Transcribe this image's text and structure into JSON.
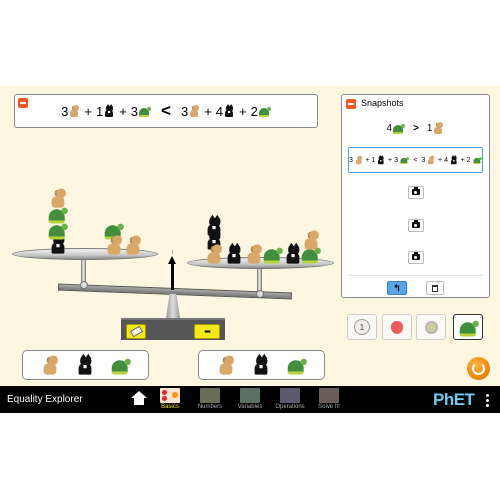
{
  "main_equation": {
    "left": [
      {
        "coefficient": "3",
        "item": "dog"
      },
      {
        "coefficient": "1",
        "item": "cat"
      },
      {
        "coefficient": "3",
        "item": "turtle"
      }
    ],
    "relation": "<",
    "right": [
      {
        "coefficient": "3",
        "item": "dog"
      },
      {
        "coefficient": "4",
        "item": "cat"
      },
      {
        "coefficient": "2",
        "item": "turtle"
      }
    ],
    "operator": "+"
  },
  "snapshots": {
    "title": "Snapshots",
    "items": [
      {
        "text_left": "4",
        "left_item": "turtle",
        "relation": ">",
        "text_right": "1",
        "right_item": "dog",
        "selected": false
      },
      {
        "left": [
          "3",
          "1",
          "3"
        ],
        "relation": "<",
        "right": [
          "3",
          "4",
          "2"
        ],
        "selected": true
      },
      {
        "empty": true,
        "icon": "camera-icon"
      },
      {
        "empty": true,
        "icon": "camera-icon"
      },
      {
        "empty": true,
        "icon": "camera-icon"
      }
    ],
    "restore_icon": "restore-arrow-icon",
    "trash_icon": "trash-icon"
  },
  "scale": {
    "tilt": "right-side-down",
    "left_pan": {
      "dog": 3,
      "cat": 1,
      "turtle": 3
    },
    "right_pan": {
      "dog": 3,
      "cat": 4,
      "turtle": 2
    },
    "clear_icon": "eraser-icon",
    "organize_icon": "organize-icon"
  },
  "left_toolbox": [
    "dog",
    "cat",
    "turtle"
  ],
  "right_toolbox": [
    "dog",
    "cat",
    "turtle"
  ],
  "scene_selector": {
    "options": [
      {
        "name": "numbers",
        "label": "1",
        "selected": false
      },
      {
        "name": "apple",
        "label": "",
        "selected": false
      },
      {
        "name": "coin",
        "label": "",
        "selected": false
      },
      {
        "name": "animals",
        "label": "",
        "selected": true
      }
    ]
  },
  "navbar": {
    "title": "Equality Explorer",
    "tabs": [
      {
        "label": "Basics",
        "selected": true
      },
      {
        "label": "Numbers",
        "selected": false
      },
      {
        "label": "Variables",
        "selected": false
      },
      {
        "label": "Operations",
        "selected": false
      },
      {
        "label": "Solve It!",
        "selected": false
      }
    ],
    "logo": "PhET",
    "colors": {
      "selected_tab": "#f2e916",
      "logo_blue": "#6fcbf0",
      "logo_yellow": "#f2e916"
    }
  },
  "colors": {
    "background": "#fdf7e2",
    "accent_orange": "#f15a22",
    "snapshot_selected_border": "#4a9fe0",
    "restore_button": "#5aa6e8"
  }
}
